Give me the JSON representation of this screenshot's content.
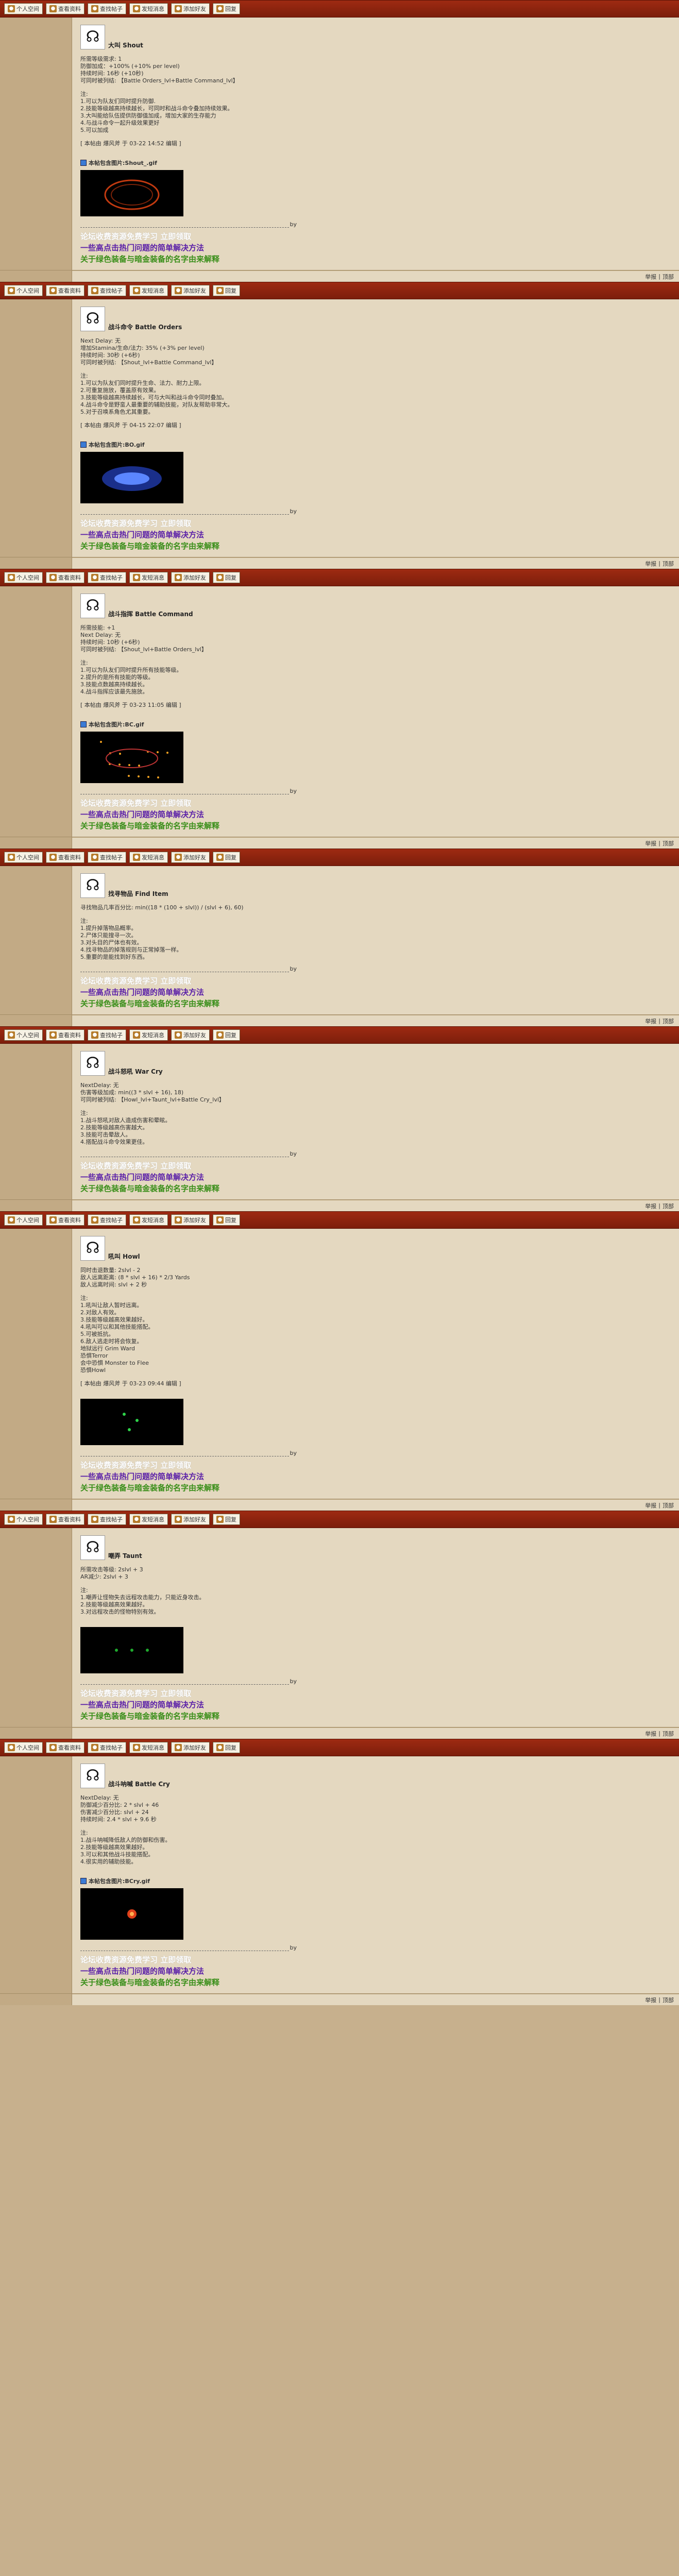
{
  "toolbar": {
    "buttons": [
      {
        "label": "个人空间",
        "icon": "home-icon"
      },
      {
        "label": "查看资料",
        "icon": "profile-icon"
      },
      {
        "label": "查找帖子",
        "icon": "search-icon"
      },
      {
        "label": "发短消息",
        "icon": "message-icon"
      },
      {
        "label": "添加好友",
        "icon": "add-friend-icon"
      },
      {
        "label": "回复",
        "icon": "reply-icon"
      }
    ]
  },
  "footer": {
    "report": "举报",
    "top": "顶部"
  },
  "signature": {
    "divider": "by",
    "line1": "论坛收费资源免费学习 立即领取",
    "line2": "一些高点击热门问题的简单解决方法",
    "line3": "关于绿色装备与暗金装备的名字由来解释"
  },
  "posts": [
    {
      "icon": "☊",
      "name": "大叫 Shout",
      "attrs": [
        "所需等级需求: 1",
        "防御加成：+100% (+10% per level)",
        "持续时间: 16秒 (+10秒)",
        "可同时被列结: 【Battle Orders_lvl+Battle Command_lvl】"
      ],
      "notes": [
        "注:",
        "1.可以为队友们同时提升防御.",
        "2.技能等级越高持续越长，可同时和战斗命令叠加持续效果。",
        "3.大叫能给队伍提供防御值加成，增加大家的生存能力",
        "4.与战斗命令一起升级效果更好",
        "5.可以加成"
      ],
      "edit": "[ 本帖由 爆风斧 于 03-22 14:52 编辑 ]",
      "attachment": "本帖包含图片:Shout_.gif",
      "gif": "ring",
      "gif_height": 90
    },
    {
      "icon": "☊",
      "name": "战斗命令 Battle Orders",
      "attrs": [
        "Next Delay: 无",
        "增加Stamina/生命/法力: 35% (+3% per level)",
        "持续时间: 30秒 (+6秒)",
        "可同时被列结: 【Shout_lvl+Battle Command_lvl】"
      ],
      "notes": [
        "注:",
        "1.可以为队友们同时提升生命、法力、耐力上限。",
        "2.可重复施放，覆盖原有效果。",
        "3.技能等级越高持续越长，可与大叫和战斗命令同时叠加。",
        "4.战斗命令是野蛮人最重要的辅助技能，对队友帮助非常大。",
        "5.对于召唤系角色尤其重要。"
      ],
      "edit": "[ 本帖由 爆风斧 于 04-15 22:07 编辑 ]",
      "attachment": "本帖包含图片:BO.gif",
      "gif": "blue",
      "gif_height": 100
    },
    {
      "icon": "☊",
      "name": "战斗指挥 Battle Command",
      "attrs": [
        "所需技能: +1",
        "Next Delay: 无",
        "持续时间: 10秒 (+6秒)",
        "可同时被列结: 【Shout_lvl+Battle Orders_lvl】"
      ],
      "notes": [
        "注:",
        "1.可以为队友们同时提升所有技能等级。",
        "2.提升的是所有技能的等级。",
        "3.技能点数越高持续越长。",
        "4.战斗指挥应该最先施放。"
      ],
      "edit": "[ 本帖由 爆风斧 于 03-23 11:05 编辑 ]",
      "attachment": "本帖包含图片:BC.gif",
      "gif": "sparks",
      "gif_height": 100
    },
    {
      "icon": "☊",
      "name": "找寻物品 Find Item",
      "attrs": [
        "寻找物品几率百分比: min((18 * (100 + slvl)) / (slvl + 6), 60)"
      ],
      "notes": [
        "注:",
        "1.提升掉落物品概率。",
        "2.尸体只能搜寻一次。",
        "3.对头目的尸体也有效。",
        "4.找寻物品的掉落规则与正常掉落一样。",
        "5.重要的是能找到好东西。"
      ],
      "edit": "",
      "attachment": "",
      "gif": "",
      "gif_height": 0
    },
    {
      "icon": "☊",
      "name": "战斗怒吼 War Cry",
      "attrs": [
        "NextDelay: 无",
        "伤害等级加成: min((3 * slvl + 16), 18)",
        "可同时被列结: 【Howl_lvl+Taunt_lvl+Battle Cry_lvl】"
      ],
      "notes": [
        "注:",
        "1.战斗怒吼对敌人造成伤害和晕眩。",
        "2.技能等级越高伤害越大。",
        "3.技能可击晕敌人。",
        "4.搭配战斗命令效果更佳。"
      ],
      "edit": "",
      "attachment": "",
      "gif": "",
      "gif_height": 0
    },
    {
      "icon": "☊",
      "name": "吼叫 Howl",
      "attrs": [
        "同时击退数量: 2slvl - 2",
        "敌人远离距离: (8 * slvl + 16) * 2/3 Yards",
        "敌人远离时间: slvl + 2 秒"
      ],
      "notes": [
        "注:",
        "1.吼叫让敌人暂时远离。",
        "2.对敌人有效。",
        "3.技能等级越高效果越好。",
        "4.吼叫可以和其他技能搭配。",
        "5.可被抵抗。",
        "6.敌人逃走时将会恢复。",
        "地狱远行 Grim Ward",
        "恐惧Terror",
        "会中恐惧 Monster to Flee",
        "恐惧Howl"
      ],
      "edit": "[ 本帖由 爆风斧 于 03-23 09:44 编辑 ]",
      "attachment": "",
      "gif": "dots",
      "gif_height": 90
    },
    {
      "icon": "☊",
      "name": "嘲弄 Taunt",
      "attrs": [
        "所需攻击等级: 2slvl + 3",
        "AR减少: 2slvl + 3"
      ],
      "notes": [
        "注:",
        "1.嘲弄让怪物失去远程攻击能力，只能近身攻击。",
        "2.技能等级越高效果越好。",
        "3.对远程攻击的怪物特别有效。"
      ],
      "edit": "",
      "attachment": "",
      "gif": "green",
      "gif_height": 90
    },
    {
      "icon": "☊",
      "name": "战斗呐喊 Battle Cry",
      "attrs": [
        "NextDelay: 无",
        "防御减少百分比: 2 * slvl + 46",
        "伤害减少百分比: slvl + 24",
        "持续时间: 2.4 * slvl + 9.6 秒"
      ],
      "notes": [
        "注:",
        "1.战斗呐喊降低敌人的防御和伤害。",
        "2.技能等级越高效果越好。",
        "3.可以和其他战斗技能搭配。",
        "4.很实用的辅助技能。"
      ],
      "edit": "",
      "attachment": "本帖包含图片:BCry.gif",
      "gif": "fire",
      "gif_height": 100
    }
  ]
}
